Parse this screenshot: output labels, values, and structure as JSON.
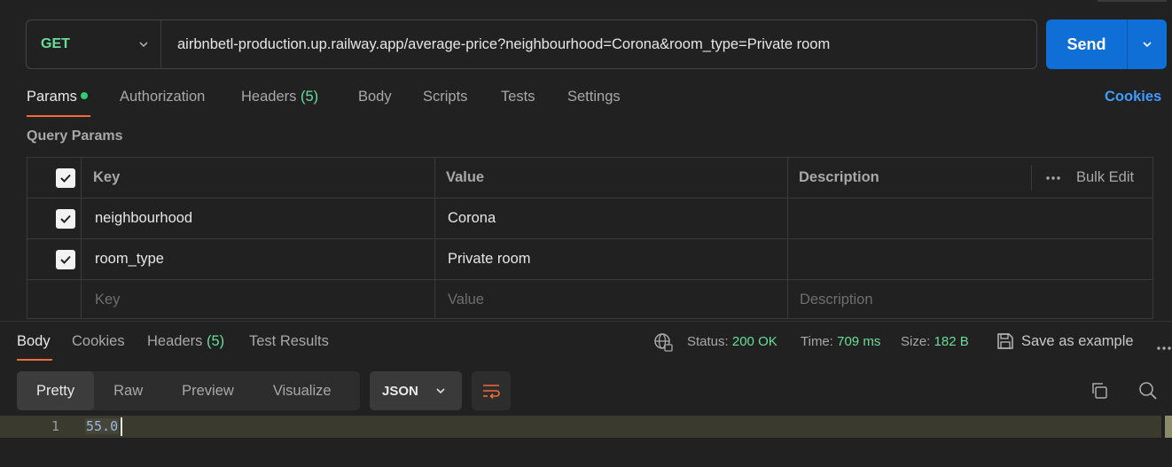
{
  "request": {
    "method": "GET",
    "url": "airbnbetl-production.up.railway.app/average-price?neighbourhood=Corona&room_type=Private room",
    "send_label": "Send"
  },
  "request_tabs": {
    "params": "Params",
    "authorization": "Authorization",
    "headers": "Headers",
    "headers_count": "(5)",
    "body": "Body",
    "scripts": "Scripts",
    "tests": "Tests",
    "settings": "Settings",
    "cookies": "Cookies"
  },
  "query_params": {
    "title": "Query Params",
    "headers": {
      "key": "Key",
      "value": "Value",
      "description": "Description",
      "bulk_edit": "Bulk Edit"
    },
    "rows": [
      {
        "key": "neighbourhood",
        "value": "Corona",
        "checked": true
      },
      {
        "key": "room_type",
        "value": "Private room",
        "checked": true
      }
    ],
    "placeholders": {
      "key": "Key",
      "value": "Value",
      "description": "Description"
    }
  },
  "response": {
    "tabs": {
      "body": "Body",
      "cookies": "Cookies",
      "headers": "Headers",
      "headers_count": "(5)",
      "test_results": "Test Results"
    },
    "status_label": "Status:",
    "status_value": "200 OK",
    "time_label": "Time:",
    "time_value": "709 ms",
    "size_label": "Size:",
    "size_value": "182 B",
    "save_example": "Save as example",
    "views": {
      "pretty": "Pretty",
      "raw": "Raw",
      "preview": "Preview",
      "visualize": "Visualize"
    },
    "format": "JSON",
    "line_number": "1",
    "body_text": "55.0"
  },
  "colors": {
    "accent_orange": "#f26b3a",
    "send_blue": "#0f6fd6",
    "success_green": "#6bdd9a",
    "link_blue": "#3e9bff"
  }
}
